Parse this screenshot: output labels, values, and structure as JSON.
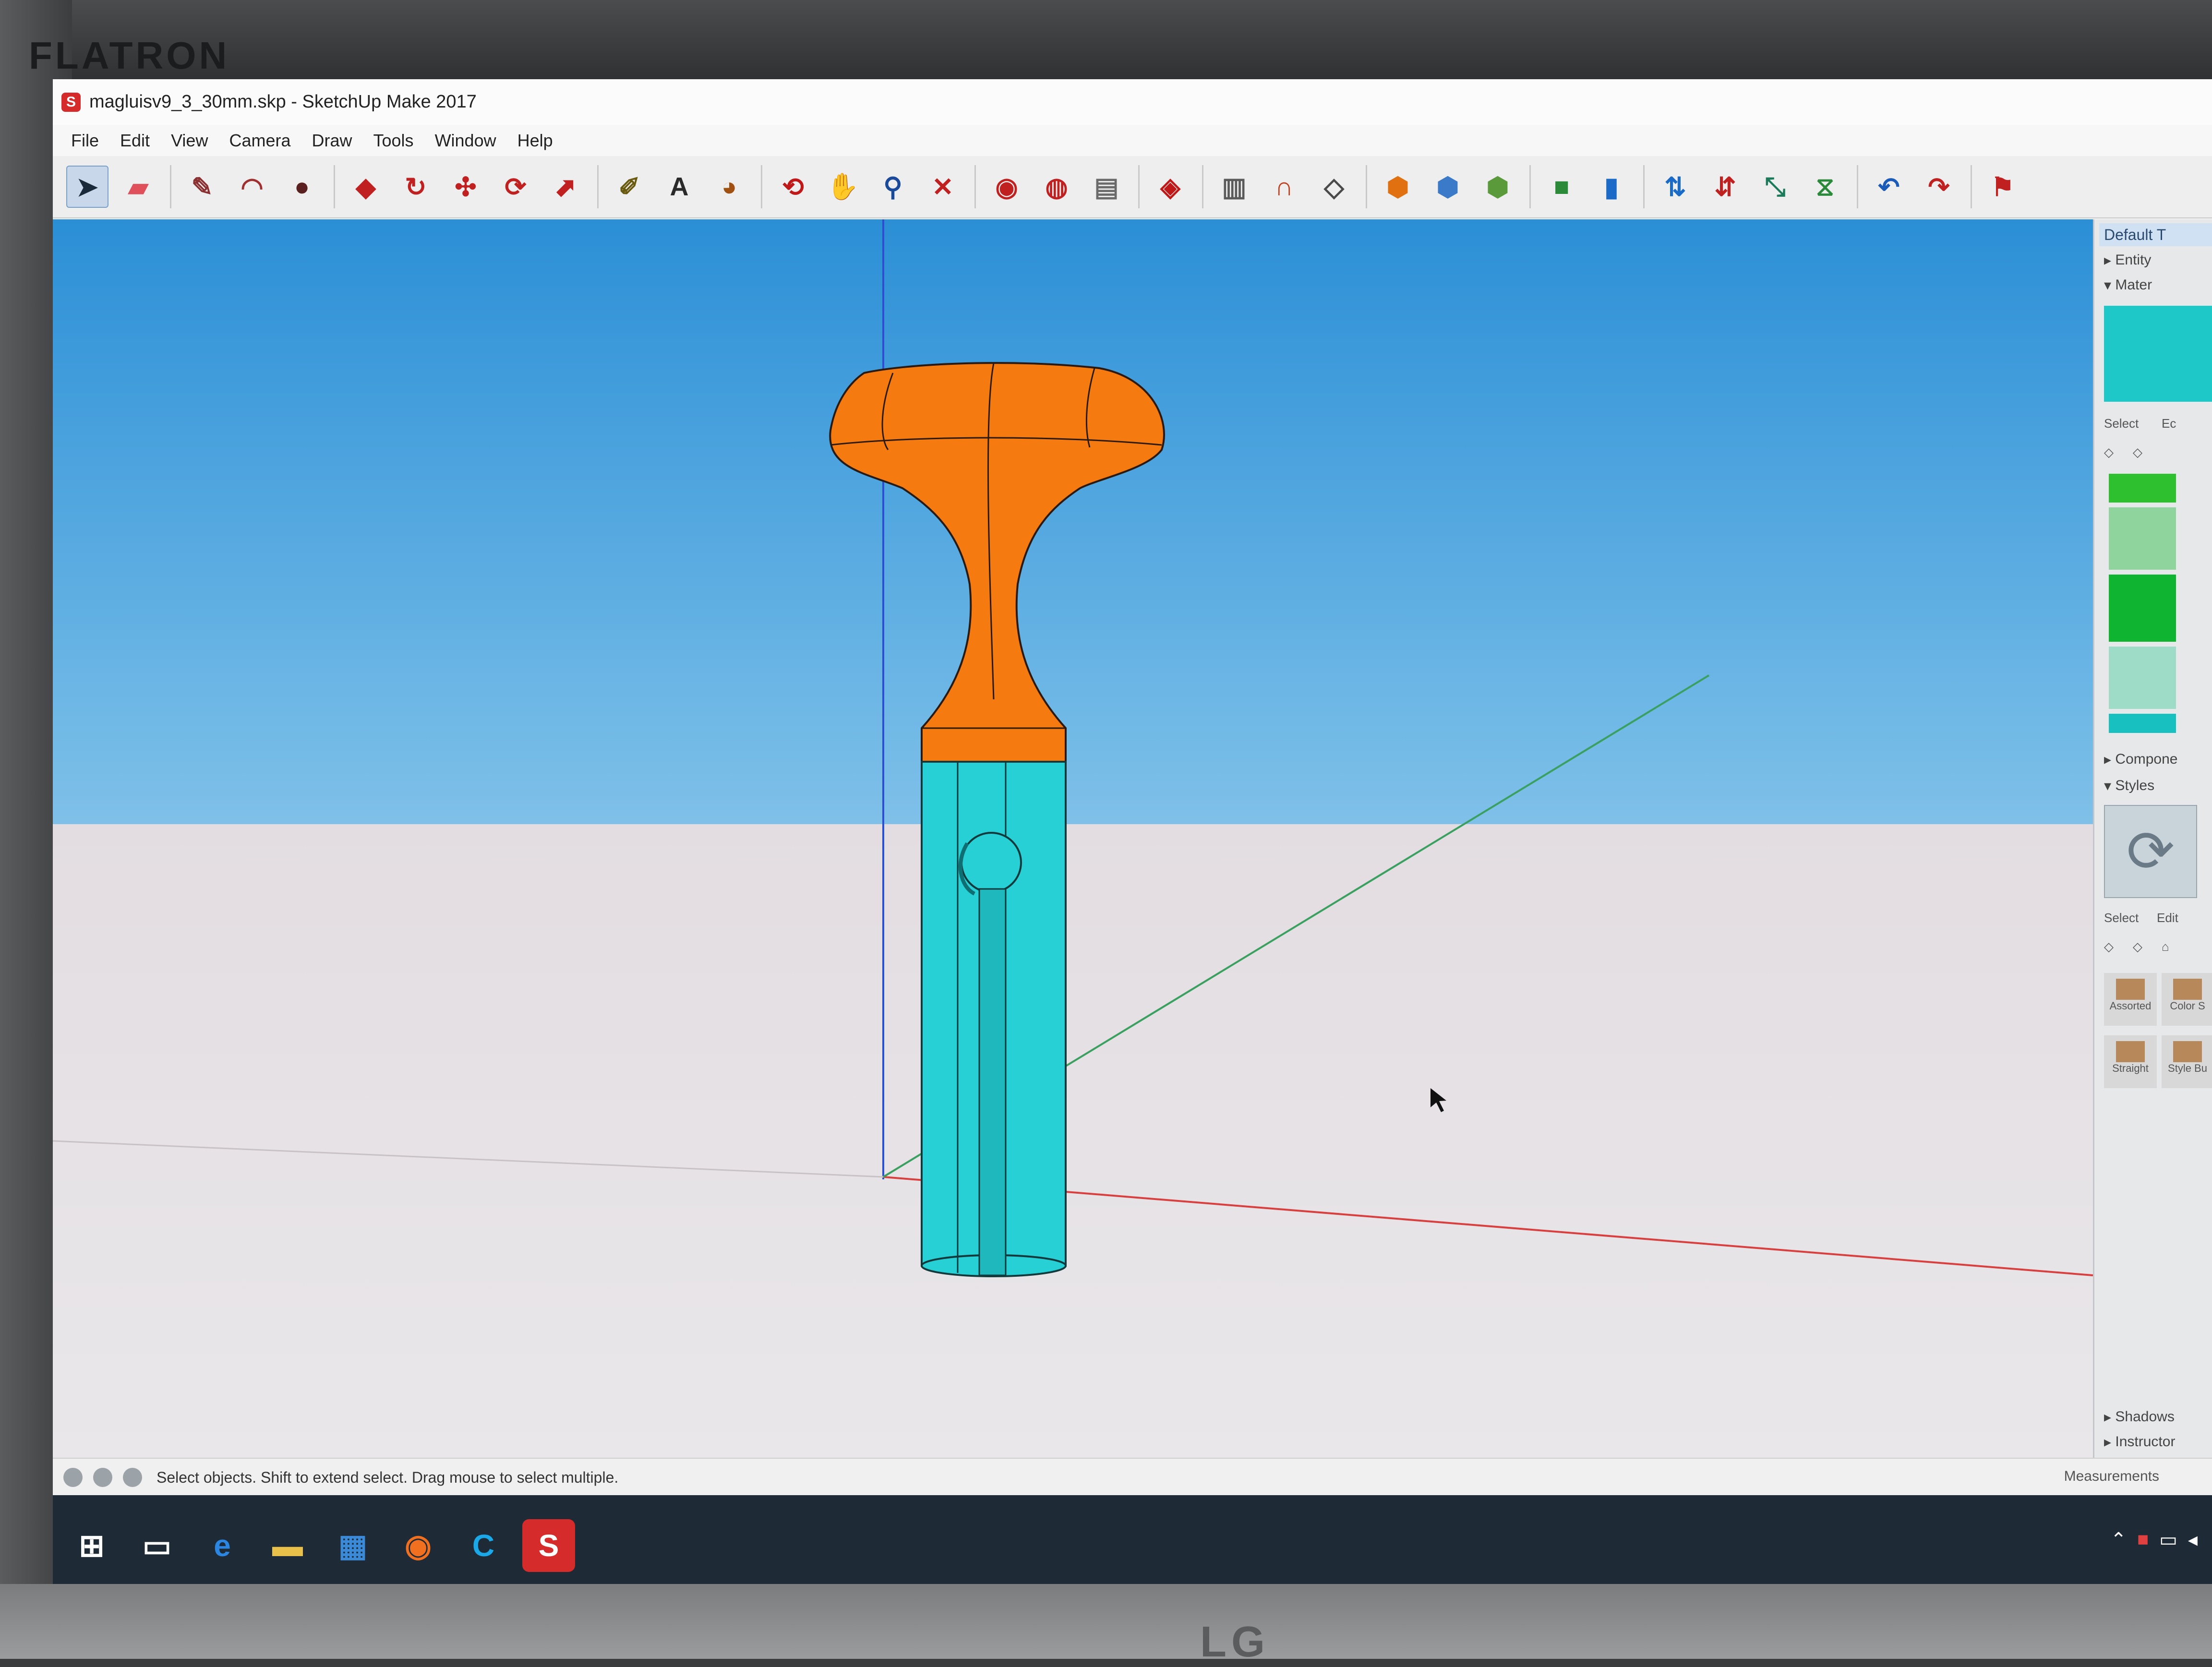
{
  "window": {
    "title": "magluisv9_3_30mm.skp - SketchUp Make 2017",
    "app_icon": "sketchup-icon"
  },
  "menu": [
    "File",
    "Edit",
    "View",
    "Camera",
    "Draw",
    "Tools",
    "Window",
    "Help"
  ],
  "toolbar": {
    "tools": [
      {
        "name": "select-tool-icon",
        "glyph": "➤",
        "color": "#1b2a3a",
        "active": true
      },
      {
        "name": "eraser-tool-icon",
        "glyph": "▰",
        "color": "#e0505a"
      },
      {
        "name": "line-tool-icon",
        "glyph": "✎",
        "color": "#8a3030"
      },
      {
        "name": "arc-tool-icon",
        "glyph": "◠",
        "color": "#a03030"
      },
      {
        "name": "shape-tool-icon",
        "glyph": "●",
        "color": "#5a2020"
      },
      {
        "name": "push-pull-tool-icon",
        "glyph": "◆",
        "color": "#c02020"
      },
      {
        "name": "follow-me-tool-icon",
        "glyph": "↻",
        "color": "#c02020"
      },
      {
        "name": "move-tool-icon",
        "glyph": "✣",
        "color": "#c02020"
      },
      {
        "name": "rotate-tool-icon",
        "glyph": "⟳",
        "color": "#c02020"
      },
      {
        "name": "scale-tool-icon",
        "glyph": "⬈",
        "color": "#c02020"
      },
      {
        "name": "tape-measure-tool-icon",
        "glyph": "✐",
        "color": "#6a5a10"
      },
      {
        "name": "text-tool-icon",
        "glyph": "A",
        "color": "#2a2a2a"
      },
      {
        "name": "paint-bucket-tool-icon",
        "glyph": "◕",
        "color": "#a05010"
      },
      {
        "name": "orbit-tool-icon",
        "glyph": "⟲",
        "color": "#c01818"
      },
      {
        "name": "pan-tool-icon",
        "glyph": "✋",
        "color": "#b08040"
      },
      {
        "name": "zoom-tool-icon",
        "glyph": "⚲",
        "color": "#1a4a9a"
      },
      {
        "name": "zoom-extents-tool-icon",
        "glyph": "✕",
        "color": "#c02020"
      },
      {
        "name": "warehouse-icon",
        "glyph": "◉",
        "color": "#c02020"
      },
      {
        "name": "extension-warehouse-icon",
        "glyph": "◍",
        "color": "#c02020"
      },
      {
        "name": "layout-icon",
        "glyph": "▤",
        "color": "#6a6a6a"
      },
      {
        "name": "ruby-icon",
        "glyph": "◈",
        "color": "#c01818"
      },
      {
        "name": "xray-icon",
        "glyph": "▥",
        "color": "#5a5a5a"
      },
      {
        "name": "back-edges-icon",
        "glyph": "∩",
        "color": "#c04020"
      },
      {
        "name": "wireframe-icon",
        "glyph": "◇",
        "color": "#4a4a4a"
      },
      {
        "name": "iso-view-icon",
        "glyph": "⬢",
        "color": "#e07010"
      },
      {
        "name": "top-view-icon",
        "glyph": "⬢",
        "color": "#3a7ac8"
      },
      {
        "name": "front-view-icon",
        "glyph": "⬢",
        "color": "#5a9a3a"
      },
      {
        "name": "solid-union-icon",
        "glyph": "■",
        "color": "#2a8a3a"
      },
      {
        "name": "solid-subtract-icon",
        "glyph": "▮",
        "color": "#1a6ac8"
      },
      {
        "name": "intersect-icon",
        "glyph": "⇅",
        "color": "#1a6ac8"
      },
      {
        "name": "flip-icon",
        "glyph": "⇵",
        "color": "#c02020"
      },
      {
        "name": "section-plane-icon",
        "glyph": "⤡",
        "color": "#1a7a5a"
      },
      {
        "name": "section-cut-icon",
        "glyph": "⧖",
        "color": "#2a8a3a"
      },
      {
        "name": "undo-icon",
        "glyph": "↶",
        "color": "#1a5ab8"
      },
      {
        "name": "redo-icon",
        "glyph": "↷",
        "color": "#c02020"
      },
      {
        "name": "walk-icon",
        "glyph": "⚑",
        "color": "#c02020"
      }
    ]
  },
  "tray": {
    "header": "Default T",
    "entity_info": "Entity",
    "materials": "Mater",
    "materials_select": "Select",
    "materials_edit": "Ec",
    "components": "Compone",
    "styles": "Styles",
    "styles_select": "Select",
    "styles_edit": "Edit",
    "style_items": [
      "Assorted",
      "Color S",
      "Straight",
      "Style Bu"
    ],
    "shadows": "Shadows",
    "instructor": "Instructor",
    "swatch_colors": [
      "#1ec8c8",
      "#2ec02e",
      "#8fd49c",
      "#0fb430",
      "#9fdcc8",
      "#18c0c0"
    ]
  },
  "model": {
    "handle_color": "#f57a10",
    "shaft_color": "#26d0d4"
  },
  "status": {
    "hint": "Select objects. Shift to extend select. Drag mouse to select multiple.",
    "measurements_label": "Measurements"
  },
  "taskbar": {
    "items": [
      {
        "name": "start-icon",
        "glyph": "⊞",
        "color": "#ffffff"
      },
      {
        "name": "task-view-icon",
        "glyph": "▭",
        "color": "#ffffff"
      },
      {
        "name": "edge-icon",
        "glyph": "e",
        "color": "#2a86e0"
      },
      {
        "name": "file-explorer-icon",
        "glyph": "▬",
        "color": "#e8c04a"
      },
      {
        "name": "store-icon",
        "glyph": "▦",
        "color": "#3a8ad8"
      },
      {
        "name": "firefox-icon",
        "glyph": "◉",
        "color": "#f07020"
      },
      {
        "name": "cura-icon",
        "glyph": "C",
        "color": "#1aa8e8"
      },
      {
        "name": "sketchup-taskbar-icon",
        "glyph": "S",
        "color": "#ffffff"
      }
    ]
  },
  "monitor": {
    "brand_top": "FLATRON",
    "brand_bottom": "LG"
  }
}
